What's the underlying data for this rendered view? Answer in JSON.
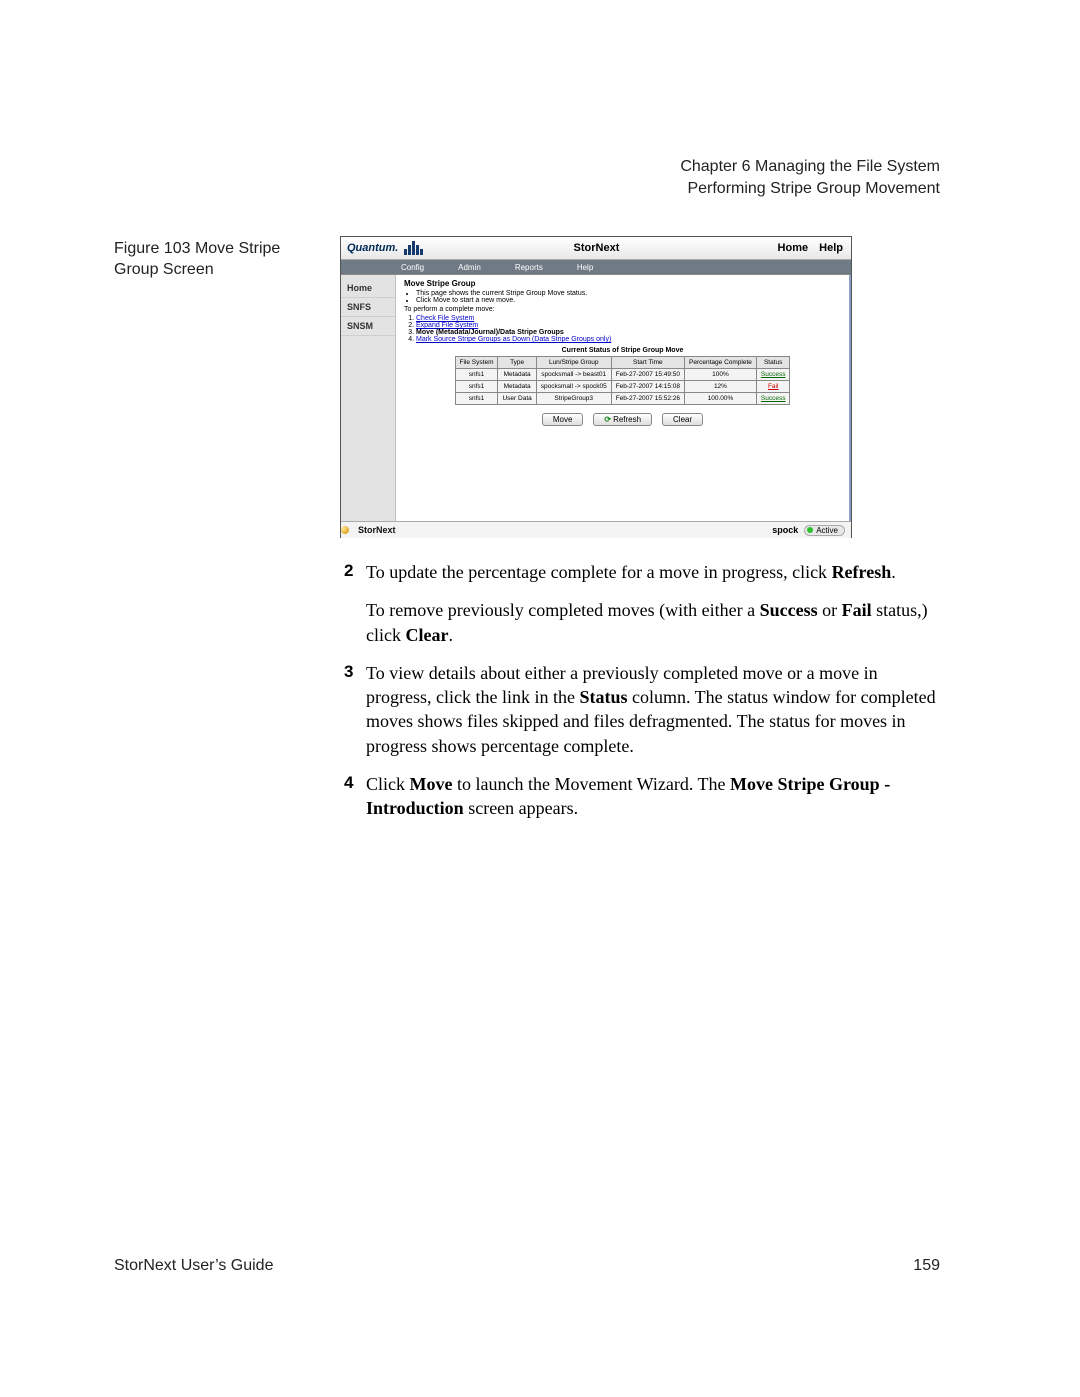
{
  "header": {
    "line1": "Chapter 6  Managing the File System",
    "line2": "Performing Stripe Group Movement"
  },
  "figure_caption": "Figure 103  Move Stripe Group Screen",
  "screenshot": {
    "brand": "Quantum.",
    "app_title": "StorNext",
    "home_label": "Home",
    "help_label": "Help",
    "menu": {
      "config": "Config",
      "admin": "Admin",
      "reports": "Reports",
      "help": "Help"
    },
    "sidebar": {
      "home": "Home",
      "snfs": "SNFS",
      "snsm": "SNSM"
    },
    "panel_title": "Move Stripe Group",
    "bullets": {
      "b1": "This page shows the current Stripe Group Move status.",
      "b2": "Click Move to start a new move."
    },
    "perform_label": "To perform a complete move:",
    "steps": {
      "s1": "Check File System",
      "s2": "Expand File System",
      "s3": "Move (Metadata/Journal)/Data Stripe Groups",
      "s4": "Mark Source Stripe Groups as Down (Data Stripe Groups only)"
    },
    "table_caption": "Current Status of Stripe Group Move",
    "columns": {
      "fs": "File System",
      "type": "Type",
      "lun": "Lun/Stripe Group",
      "start": "Start Time",
      "pct": "Percentage Complete",
      "status": "Status"
    },
    "rows": [
      {
        "fs": "snfs1",
        "type": "Metadata",
        "lun": "spocksmall -> beast01",
        "start": "Feb-27-2007 15:49:50",
        "pct": "100%",
        "status": "Success",
        "ok": true
      },
      {
        "fs": "snfs1",
        "type": "Metadata",
        "lun": "spocksmall -> spock05",
        "start": "Feb-27-2007 14:15:08",
        "pct": "12%",
        "status": "Fail",
        "ok": false
      },
      {
        "fs": "snfs1",
        "type": "User Data",
        "lun": "StripeGroup3",
        "start": "Feb-27-2007 15:52:26",
        "pct": "100.00%",
        "status": "Success",
        "ok": true
      }
    ],
    "buttons": {
      "move": "Move",
      "refresh": "Refresh",
      "clear": "Clear"
    },
    "footer": {
      "product": "StorNext",
      "host": "spock",
      "state": "Active"
    }
  },
  "steps": {
    "s2": {
      "num": "2",
      "p1a": "To update the percentage complete for a move in progress, click ",
      "p1b": "Refresh",
      "p1c": ".",
      "p2a": "To remove previously completed moves (with either a ",
      "p2b": "Success",
      "p2c": " or ",
      "p2d": "Fail",
      "p2e": " status,) click ",
      "p2f": "Clear",
      "p2g": "."
    },
    "s3": {
      "num": "3",
      "p1a": "To view details about either a previously completed move or a move in progress, click the link in the ",
      "p1b": "Status",
      "p1c": " column. The status window for completed moves shows files skipped and files defragmented. The status for moves in progress shows percentage complete."
    },
    "s4": {
      "num": "4",
      "p1a": "Click ",
      "p1b": "Move",
      "p1c": " to launch the Movement Wizard. The ",
      "p1d": "Move Stripe Group - Introduction",
      "p1e": " screen appears."
    }
  },
  "footer": {
    "guide": "StorNext User’s Guide",
    "page": "159"
  }
}
